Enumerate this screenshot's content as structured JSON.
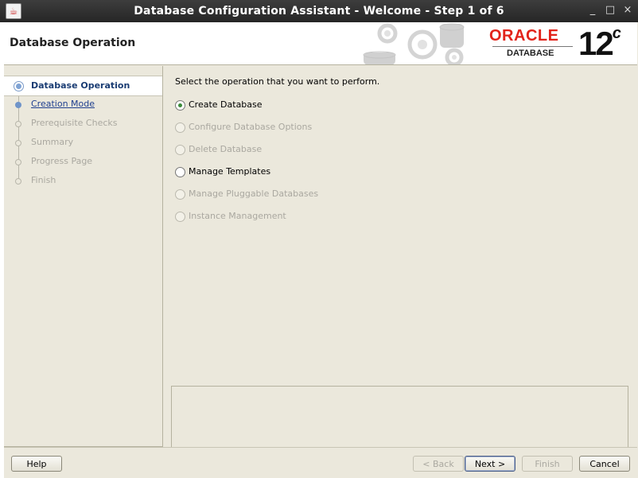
{
  "window": {
    "title": "Database Configuration Assistant - Welcome - Step 1 of 6",
    "minimize_glyph": "_",
    "maximize_glyph": "□",
    "close_glyph": "×",
    "app_icon": "java-icon"
  },
  "header": {
    "page_title": "Database Operation",
    "logo": {
      "brand": "ORACLE",
      "product": "DATABASE",
      "version": "12",
      "version_suffix": "c"
    }
  },
  "nav": {
    "steps": [
      {
        "label": "Database Operation",
        "state": "active"
      },
      {
        "label": "Creation Mode",
        "state": "link"
      },
      {
        "label": "Prerequisite Checks",
        "state": "disabled"
      },
      {
        "label": "Summary",
        "state": "disabled"
      },
      {
        "label": "Progress Page",
        "state": "disabled"
      },
      {
        "label": "Finish",
        "state": "disabled"
      }
    ]
  },
  "content": {
    "prompt": "Select the operation that you want to perform.",
    "options": [
      {
        "label": "Create Database",
        "selected": true,
        "enabled": true
      },
      {
        "label": "Configure Database Options",
        "selected": false,
        "enabled": false
      },
      {
        "label": "Delete Database",
        "selected": false,
        "enabled": false
      },
      {
        "label": "Manage Templates",
        "selected": false,
        "enabled": true
      },
      {
        "label": "Manage Pluggable Databases",
        "selected": false,
        "enabled": false
      },
      {
        "label": "Instance Management",
        "selected": false,
        "enabled": false
      }
    ],
    "message": ""
  },
  "buttons": {
    "help": "Help",
    "back": "< Back",
    "next": "Next >",
    "finish": "Finish",
    "cancel": "Cancel"
  },
  "colors": {
    "accent": "#1a3c73",
    "selected_radio": "#3a8a3a",
    "oracle_red": "#e2231a"
  }
}
